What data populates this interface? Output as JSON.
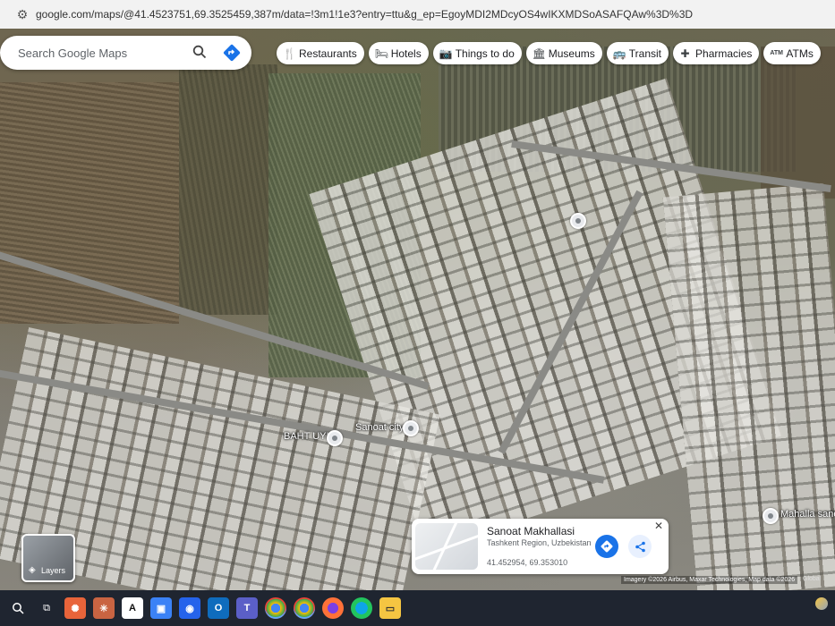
{
  "browser": {
    "url": "google.com/maps/@41.4523751,69.3525459,387m/data=!3m1!1e3?entry=ttu&g_ep=EgoyMDI2MDcyOS4wIKXMDSoASAFQAw%3D%3D"
  },
  "search": {
    "placeholder": "Search Google Maps",
    "search_icon": "search-icon",
    "directions_icon": "directions-icon"
  },
  "chips": [
    {
      "label": "Restaurants",
      "icon": "fork-knife-icon"
    },
    {
      "label": "Hotels",
      "icon": "bed-icon"
    },
    {
      "label": "Things to do",
      "icon": "camera-icon"
    },
    {
      "label": "Museums",
      "icon": "museum-icon"
    },
    {
      "label": "Transit",
      "icon": "bus-icon"
    },
    {
      "label": "Pharmacies",
      "icon": "pharmacy-icon"
    },
    {
      "label": "ATMs",
      "icon": "atm-icon"
    }
  ],
  "map_labels": {
    "baht_uyi": "BAHT UYI",
    "sanoat_city": "Sanoat city",
    "mahalla": "Mahalla sanoat"
  },
  "place_card": {
    "title": "Sanoat Makhallasi",
    "region": "Tashkent Region, Uzbekistan",
    "coords": "41.452954, 69.353010",
    "close": "✕"
  },
  "layers": {
    "label": "Layers"
  },
  "attribution": {
    "text": "Imagery ©2026 Airbus, Maxar Technologies, Map data ©2026",
    "global": "Global"
  },
  "taskbar": {
    "icons": [
      "search-icon",
      "task-view-icon",
      "chatgpt-icon",
      "claude-icon",
      "notion-icon",
      "photos-icon",
      "outlook-icon",
      "teams-icon",
      "chrome-icon",
      "chrome-icon",
      "firefox-icon",
      "edge-icon",
      "file-explorer-icon"
    ]
  },
  "colors": {
    "accent": "#1a73e8"
  }
}
